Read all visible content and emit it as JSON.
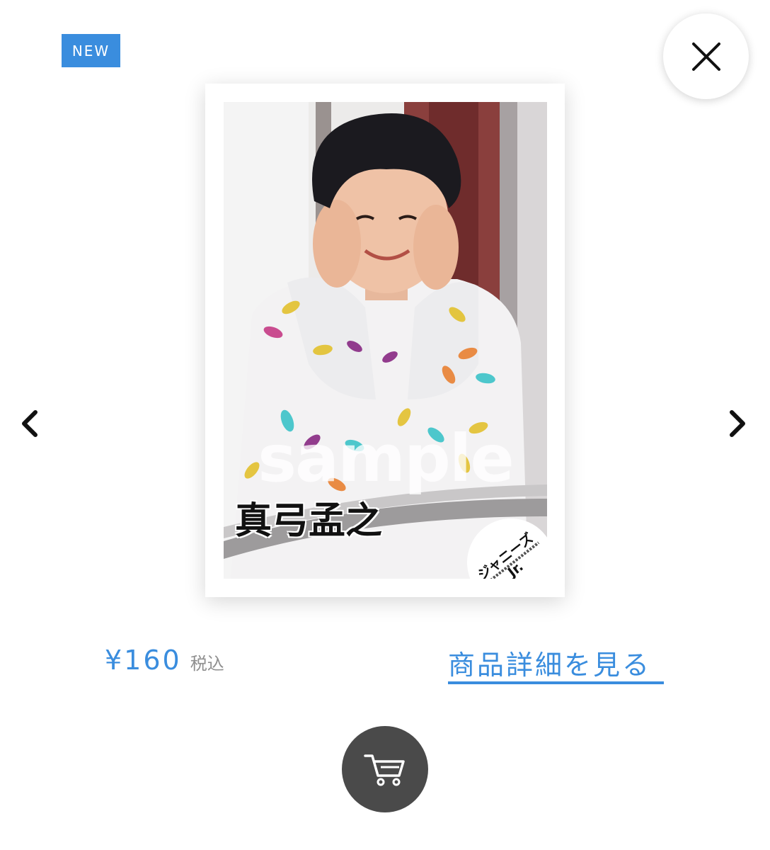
{
  "badge": {
    "label": "NEW"
  },
  "photo": {
    "watermark": "sample",
    "name_caption": "真弓孟之",
    "logo_text": "ジャニーズJr."
  },
  "product": {
    "price": "¥160",
    "tax_label": "税込",
    "detail_link": "商品詳細を見る"
  },
  "colors": {
    "accent": "#3a8dde",
    "cart_button": "#4a4a4a",
    "text_muted": "#8f8f8f"
  },
  "icons": {
    "close": "close-icon",
    "prev": "chevron-left-icon",
    "next": "chevron-right-icon",
    "cart": "cart-icon"
  }
}
